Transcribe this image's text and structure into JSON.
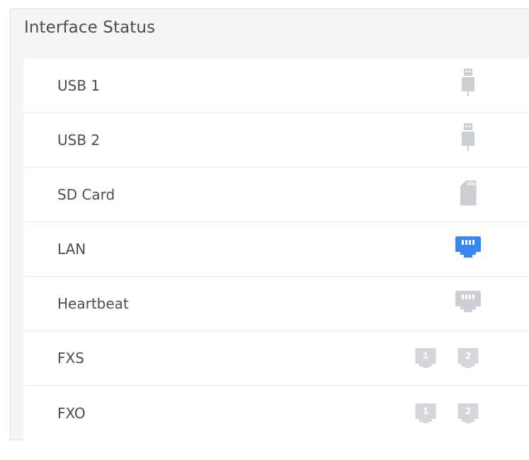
{
  "panel": {
    "title": "Interface Status"
  },
  "rows": [
    {
      "label": "USB 1",
      "icon": "usb-icon",
      "status": "inactive"
    },
    {
      "label": "USB 2",
      "icon": "usb-icon",
      "status": "inactive"
    },
    {
      "label": "SD Card",
      "icon": "sd-card-icon",
      "status": "inactive"
    },
    {
      "label": "LAN",
      "icon": "ethernet-port-icon",
      "status": "active"
    },
    {
      "label": "Heartbeat",
      "icon": "ethernet-port-icon",
      "status": "inactive"
    },
    {
      "label": "FXS",
      "icon": "analog-port-icon",
      "ports": [
        "1",
        "2"
      ],
      "status": "inactive"
    },
    {
      "label": "FXO",
      "icon": "analog-port-icon",
      "ports": [
        "1",
        "2"
      ],
      "status": "inactive"
    }
  ],
  "colors": {
    "active": "#3a86f0",
    "inactive": "#cbced3",
    "port_inactive": "#d3d6db"
  }
}
